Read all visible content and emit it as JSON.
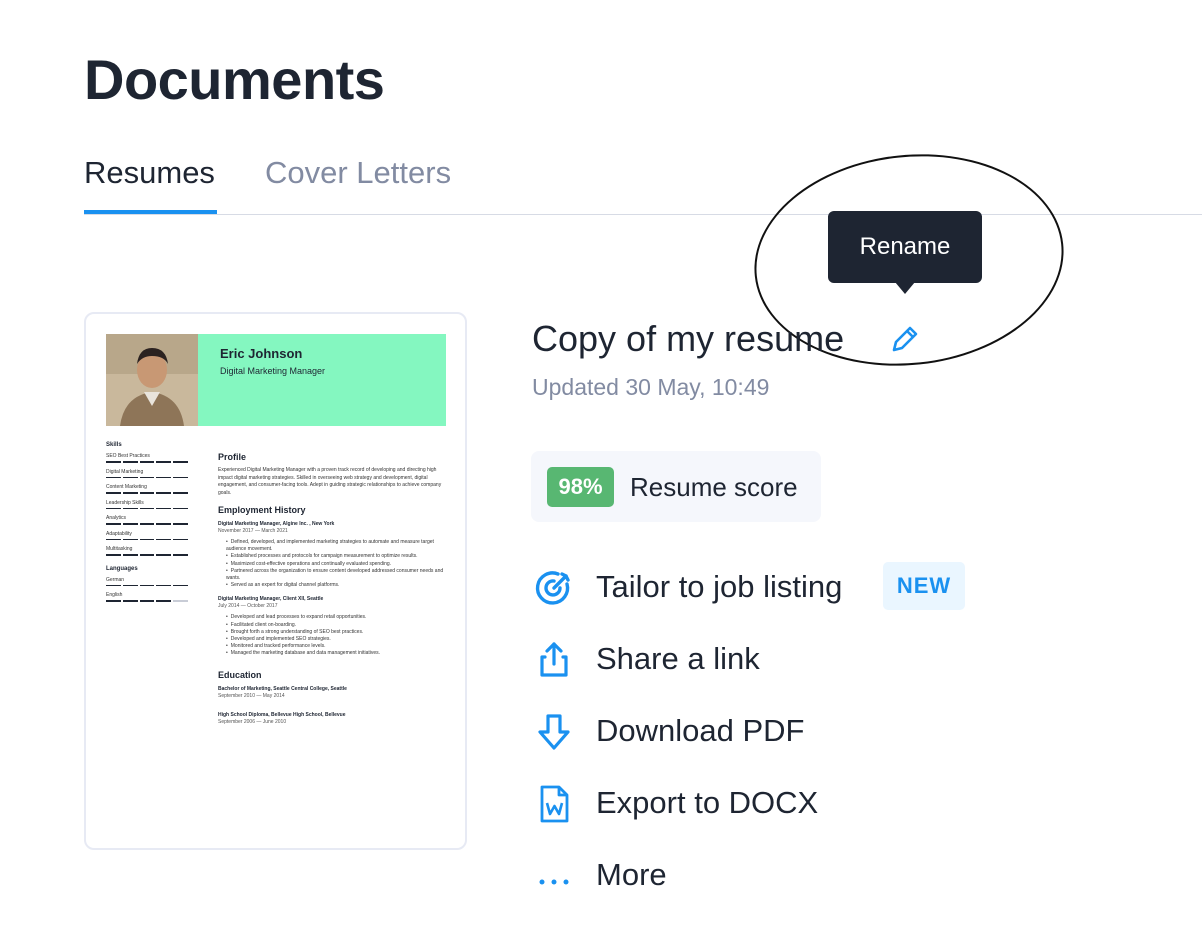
{
  "page": {
    "title": "Documents"
  },
  "tabs": [
    {
      "label": "Resumes",
      "active": true
    },
    {
      "label": "Cover Letters",
      "active": false
    }
  ],
  "document": {
    "title": "Copy of my resume",
    "updated": "Updated 30 May, 10:49",
    "edit_icon": "pencil-icon",
    "tooltip": "Rename"
  },
  "score": {
    "value": "98%",
    "label": "Resume score",
    "color": "#58b772"
  },
  "actions": [
    {
      "label": "Tailor to job listing",
      "icon": "target-icon",
      "badge": "NEW"
    },
    {
      "label": "Share a link",
      "icon": "share-icon"
    },
    {
      "label": "Download PDF",
      "icon": "download-icon"
    },
    {
      "label": "Export to DOCX",
      "icon": "docx-icon"
    },
    {
      "label": "More",
      "icon": "more-dots-icon"
    }
  ],
  "accent_color": "#1a91f0",
  "resume_preview": {
    "name": "Eric Johnson",
    "role": "Digital Marketing Manager",
    "skills_heading": "Skills",
    "skills": [
      "SEO Best Practices",
      "Digital Marketing",
      "Content Marketing",
      "Leadership Skills",
      "Analytics",
      "Adaptability",
      "Multitasking"
    ],
    "languages_heading": "Languages",
    "languages": [
      "German",
      "English"
    ],
    "profile_heading": "Profile",
    "profile": "Experienced Digital Marketing Manager with a proven track record of developing and directing high impact digital marketing strategies. Skilled in overseeing web strategy and development, digital engagement, and consumer-facing tools. Adept in guiding strategic relationships to achieve company goals.",
    "employment_heading": "Employment History",
    "job1_title": "Digital Marketing Manager, Algine Inc. , New York",
    "job1_dates": "November 2017 — March 2021",
    "job1_bullets": [
      "Defined, developed, and implemented marketing strategies to automate and measure target audience movement.",
      "Established processes and protocols for campaign measurement to optimize results.",
      "Maximized cost-effective operations and continually evaluated spending.",
      "Partnered across the organization to ensure content developed addressed consumer needs and wants.",
      "Served as an expert for digital channel platforms."
    ],
    "job2_title": "Digital Marketing Manager, Client XII, Seattle",
    "job2_dates": "July 2014 — October 2017",
    "job2_bullets": [
      "Developed and lead processes to expand retail opportunities.",
      "Facilitated client on-boarding.",
      "Brought forth a strong understanding of SEO best practices.",
      "Developed and implemented SEO strategies.",
      "Monitored and tracked performance levels.",
      "Managed the marketing database and data management initiatives."
    ],
    "education_heading": "Education",
    "edu1_title": "Bachelor of Marketing, Seattle Central College, Seattle",
    "edu1_dates": "September 2010 — May 2014",
    "edu2_title": "High School Diploma, Bellevue High School, Bellevue",
    "edu2_dates": "September 2006 — June 2010"
  }
}
